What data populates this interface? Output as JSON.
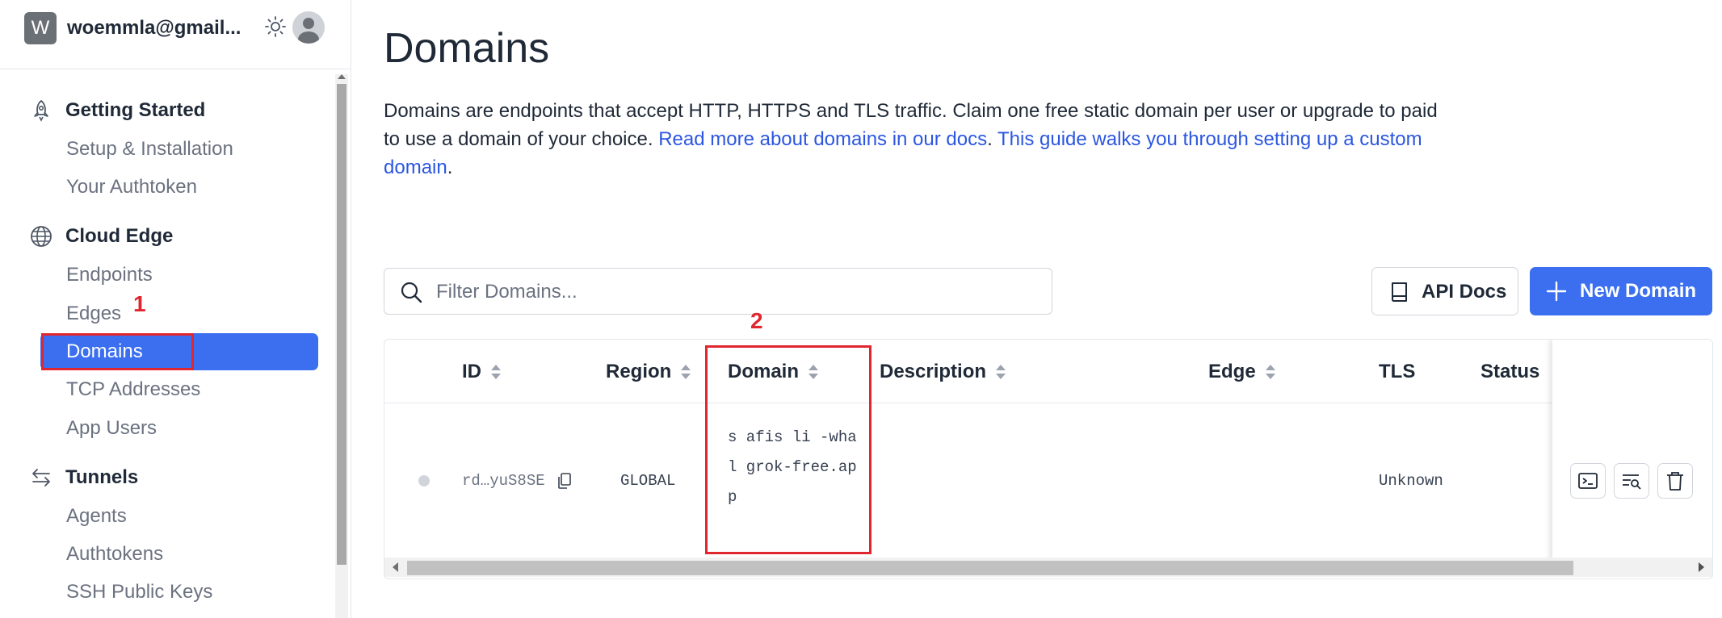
{
  "account": {
    "avatar_letter": "W",
    "email": "woemmla@gmail..."
  },
  "sidebar": {
    "sections": [
      {
        "title": "Getting Started",
        "icon": "rocket-icon",
        "items": [
          "Setup & Installation",
          "Your Authtoken"
        ]
      },
      {
        "title": "Cloud Edge",
        "icon": "globe-icon",
        "items": [
          "Endpoints",
          "Edges",
          "Domains",
          "TCP Addresses",
          "App Users"
        ]
      },
      {
        "title": "Tunnels",
        "icon": "arrows-exchange-icon",
        "items": [
          "Agents",
          "Authtokens",
          "SSH Public Keys"
        ]
      }
    ],
    "active_item": "Domains"
  },
  "annotations": {
    "one": "1",
    "two": "2"
  },
  "page": {
    "title": "Domains",
    "description_text": "Domains are endpoints that accept HTTP, HTTPS and TLS traffic. Claim one free static domain per user or upgrade to paid to use a domain of your choice. ",
    "docs_link": "Read more about domains in our docs",
    "period1": ".",
    "guide_link": "This guide walks you through setting up a custom domain",
    "period2": "."
  },
  "toolbar": {
    "search_placeholder": "Filter Domains...",
    "api_docs_label": "API Docs",
    "new_domain_label": "New Domain"
  },
  "table": {
    "columns": [
      "ID",
      "Region",
      "Domain",
      "Description",
      "Edge",
      "TLS",
      "Status"
    ],
    "rows": [
      {
        "id": "rd…yuS8SE",
        "region": "GLOBAL",
        "domain": "s  afis   li  -whal   grok-free.app",
        "description": "",
        "edge": "",
        "tls": "Unknown",
        "status": ""
      }
    ]
  },
  "colors": {
    "accent": "#3b6ff0",
    "link": "#2b56e0",
    "annotation": "#e0262e"
  }
}
